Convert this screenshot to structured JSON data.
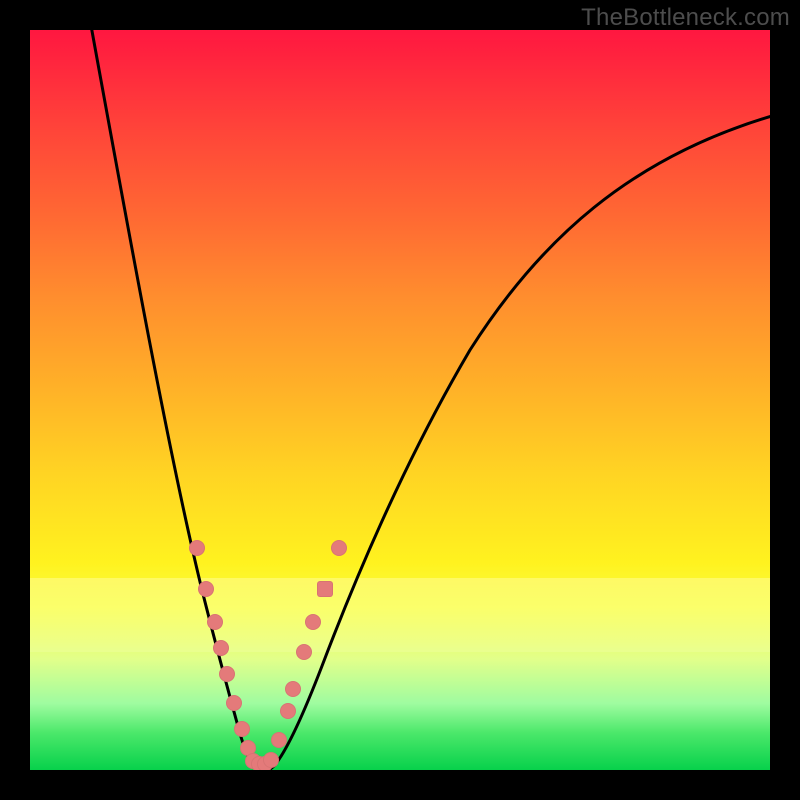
{
  "chart_data": {
    "type": "line",
    "watermark": "TheBottleneck.com",
    "xlim": [
      0,
      100
    ],
    "ylim": [
      0,
      100
    ],
    "title": "",
    "xlabel": "",
    "ylabel": "",
    "curve": [
      {
        "x": 8,
        "y": 100
      },
      {
        "x": 17,
        "y": 55
      },
      {
        "x": 23,
        "y": 25
      },
      {
        "x": 28,
        "y": 6
      },
      {
        "x": 31,
        "y": 0
      },
      {
        "x": 34,
        "y": 3
      },
      {
        "x": 40,
        "y": 18
      },
      {
        "x": 52,
        "y": 47
      },
      {
        "x": 70,
        "y": 72
      },
      {
        "x": 100,
        "y": 88
      }
    ],
    "scatter_left": [
      {
        "x": 22.5,
        "y": 30.0
      },
      {
        "x": 23.8,
        "y": 24.5
      },
      {
        "x": 25.0,
        "y": 20.0
      },
      {
        "x": 25.8,
        "y": 16.5
      },
      {
        "x": 26.6,
        "y": 13.0
      },
      {
        "x": 27.6,
        "y": 9.0
      },
      {
        "x": 28.6,
        "y": 5.5
      },
      {
        "x": 29.4,
        "y": 3.0
      }
    ],
    "scatter_bottom": [
      {
        "x": 30.2,
        "y": 1.2
      },
      {
        "x": 31.0,
        "y": 0.8
      },
      {
        "x": 31.8,
        "y": 0.8
      },
      {
        "x": 32.6,
        "y": 1.4
      }
    ],
    "scatter_right": [
      {
        "x": 33.6,
        "y": 4.0
      },
      {
        "x": 34.8,
        "y": 8.0
      },
      {
        "x": 35.6,
        "y": 11.0
      },
      {
        "x": 37.0,
        "y": 16.0
      },
      {
        "x": 38.2,
        "y": 20.0
      },
      {
        "x": 39.8,
        "y": 24.5,
        "square": true
      },
      {
        "x": 41.8,
        "y": 30.0
      }
    ],
    "colors": {
      "top": "#ff1740",
      "mid": "#ffd423",
      "bottom": "#07d14b",
      "dot": "#e47a7a",
      "curve": "#000000"
    }
  }
}
